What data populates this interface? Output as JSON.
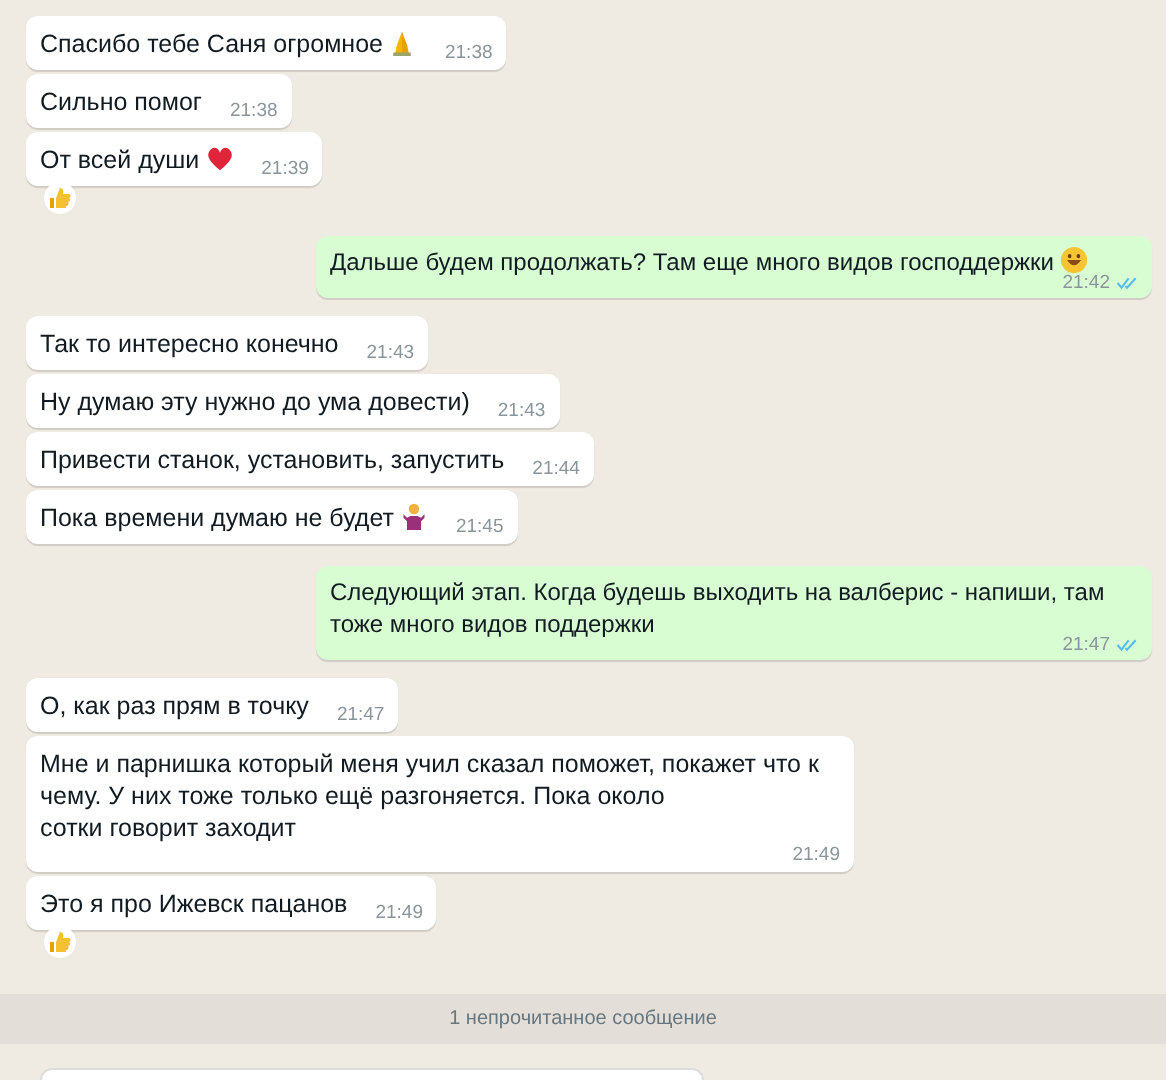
{
  "messages": [
    {
      "kind": "incoming",
      "text": "Спасибо тебе Саня огромное",
      "emoji": {
        "kind": "pray"
      },
      "time": "21:38",
      "reaction": false
    },
    {
      "kind": "incoming",
      "text": "Сильно помог",
      "time": "21:38",
      "reaction": false
    },
    {
      "kind": "incoming",
      "text": "От всей души",
      "emoji": {
        "kind": "heart"
      },
      "time": "21:39",
      "reaction": true
    },
    {
      "kind": "outgoing",
      "text": "Дальше будем продолжать? Там еще много видов господдержки",
      "emoji": {
        "kind": "smile"
      },
      "time": "21:42",
      "read": true
    },
    {
      "kind": "incoming",
      "text": "Так то интересно конечно",
      "time": "21:43",
      "reaction": false
    },
    {
      "kind": "incoming",
      "text": "Ну думаю эту нужно до ума довести)",
      "time": "21:43",
      "reaction": false
    },
    {
      "kind": "incoming",
      "text": "Привести станок, установить, запустить",
      "time": "21:44",
      "reaction": false
    },
    {
      "kind": "incoming",
      "text": "Пока времени думаю не будет",
      "emoji": {
        "kind": "shrug"
      },
      "time": "21:45",
      "reaction": false
    },
    {
      "kind": "outgoing",
      "text": "Следующий этап. Когда будешь выходить на валберис - напиши, там тоже много видов поддержки",
      "time": "21:47",
      "read": true
    },
    {
      "kind": "incoming",
      "text": "О, как раз прям в точку",
      "time": "21:47",
      "reaction": false
    },
    {
      "kind": "incoming",
      "text": "Мне и парнишка который меня учил сказал поможет, покажет что к чему. У них тоже только ещё разгоняется. Пока около\nсотки говорит заходит",
      "time": "21:49",
      "reaction": false
    },
    {
      "kind": "incoming",
      "text": "Это я про Ижевск пацанов",
      "time": "21:49",
      "reaction": true
    }
  ],
  "unread_divider": "1 непрочитанное сообщение"
}
